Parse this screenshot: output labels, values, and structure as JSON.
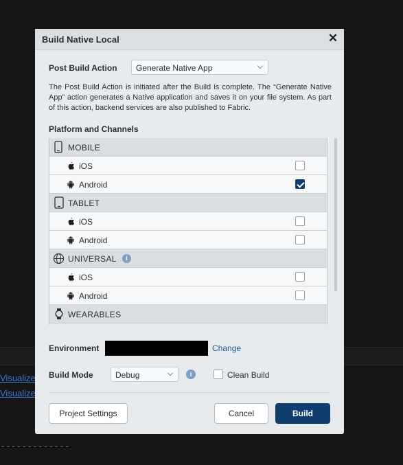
{
  "background": {
    "links": [
      "Visualizer",
      "Visualizer"
    ],
    "dashes": "-------------"
  },
  "dialog": {
    "title": "Build Native Local",
    "post_build_action": {
      "label": "Post Build Action",
      "value": "Generate Native App"
    },
    "description": "The Post Build Action is initiated after the Build is complete. The “Generate Native App” action generates a Native application and saves it on your file system. As part of this action, backend services are also published to Fabric.",
    "platform_label": "Platform and Channels",
    "groups": [
      {
        "name": "MOBILE",
        "icon": "mobile-phone-icon",
        "items": [
          {
            "name": "iOS",
            "icon": "apple-icon",
            "checked": false
          },
          {
            "name": "Android",
            "icon": "android-icon",
            "checked": true
          }
        ]
      },
      {
        "name": "TABLET",
        "icon": "tablet-icon",
        "items": [
          {
            "name": "iOS",
            "icon": "apple-icon",
            "checked": false
          },
          {
            "name": "Android",
            "icon": "android-icon",
            "checked": false
          }
        ]
      },
      {
        "name": "UNIVERSAL",
        "icon": "globe-icon",
        "has_info": true,
        "items": [
          {
            "name": "iOS",
            "icon": "apple-icon",
            "checked": false
          },
          {
            "name": "Android",
            "icon": "android-icon",
            "checked": false
          }
        ]
      },
      {
        "name": "WEARABLES",
        "icon": "watch-icon",
        "items": []
      }
    ],
    "environment": {
      "label": "Environment",
      "change_label": "Change"
    },
    "build_mode": {
      "label": "Build Mode",
      "value": "Debug"
    },
    "clean_build": {
      "label": "Clean Build",
      "checked": false
    },
    "buttons": {
      "project_settings": "Project Settings",
      "cancel": "Cancel",
      "build": "Build"
    },
    "colors": {
      "primary": "#0f3d6e",
      "link": "#1f5a94",
      "info": "#7c9fc3"
    }
  }
}
